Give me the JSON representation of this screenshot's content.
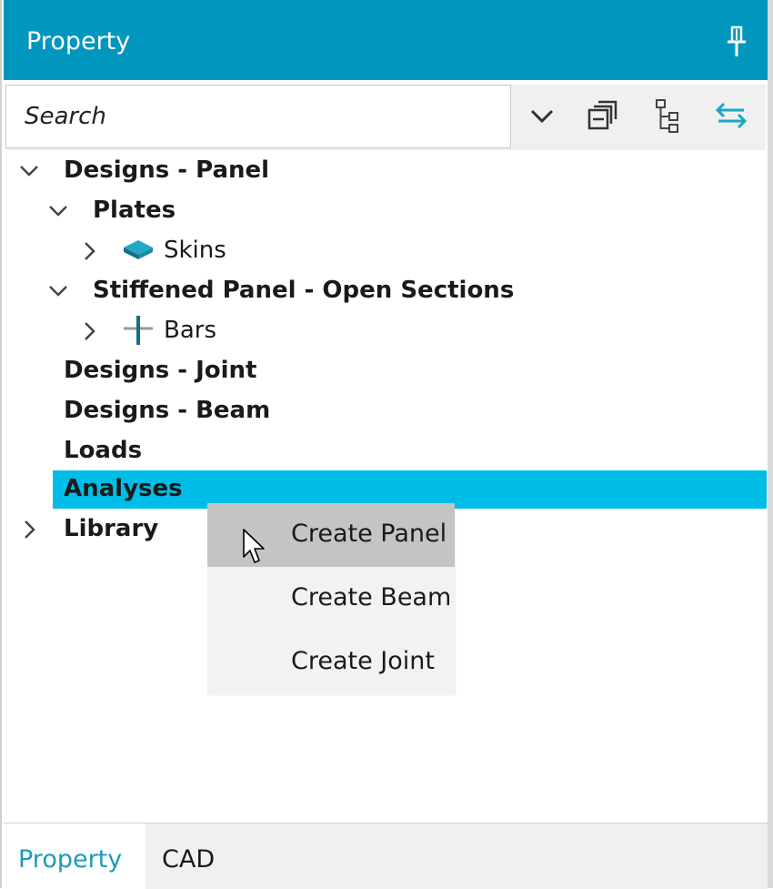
{
  "header": {
    "title": "Property"
  },
  "toolbar": {
    "search_placeholder": "Search"
  },
  "tree": {
    "designs_panel": "Designs - Panel",
    "plates": "Plates",
    "skins": "Skins",
    "stiffened": "Stiffened Panel - Open Sections",
    "bars": "Bars",
    "designs_joint": "Designs - Joint",
    "designs_beam": "Designs - Beam",
    "loads": "Loads",
    "analyses": "Analyses",
    "library": "Library"
  },
  "context_menu": {
    "create_panel": "Create Panel",
    "create_beam": "Create Beam",
    "create_joint": "Create Joint"
  },
  "tabs": {
    "property": "Property",
    "cad": "CAD"
  },
  "colors": {
    "header": "#0096bd",
    "selection": "#00bde8",
    "accent": "#1a9bb8"
  }
}
